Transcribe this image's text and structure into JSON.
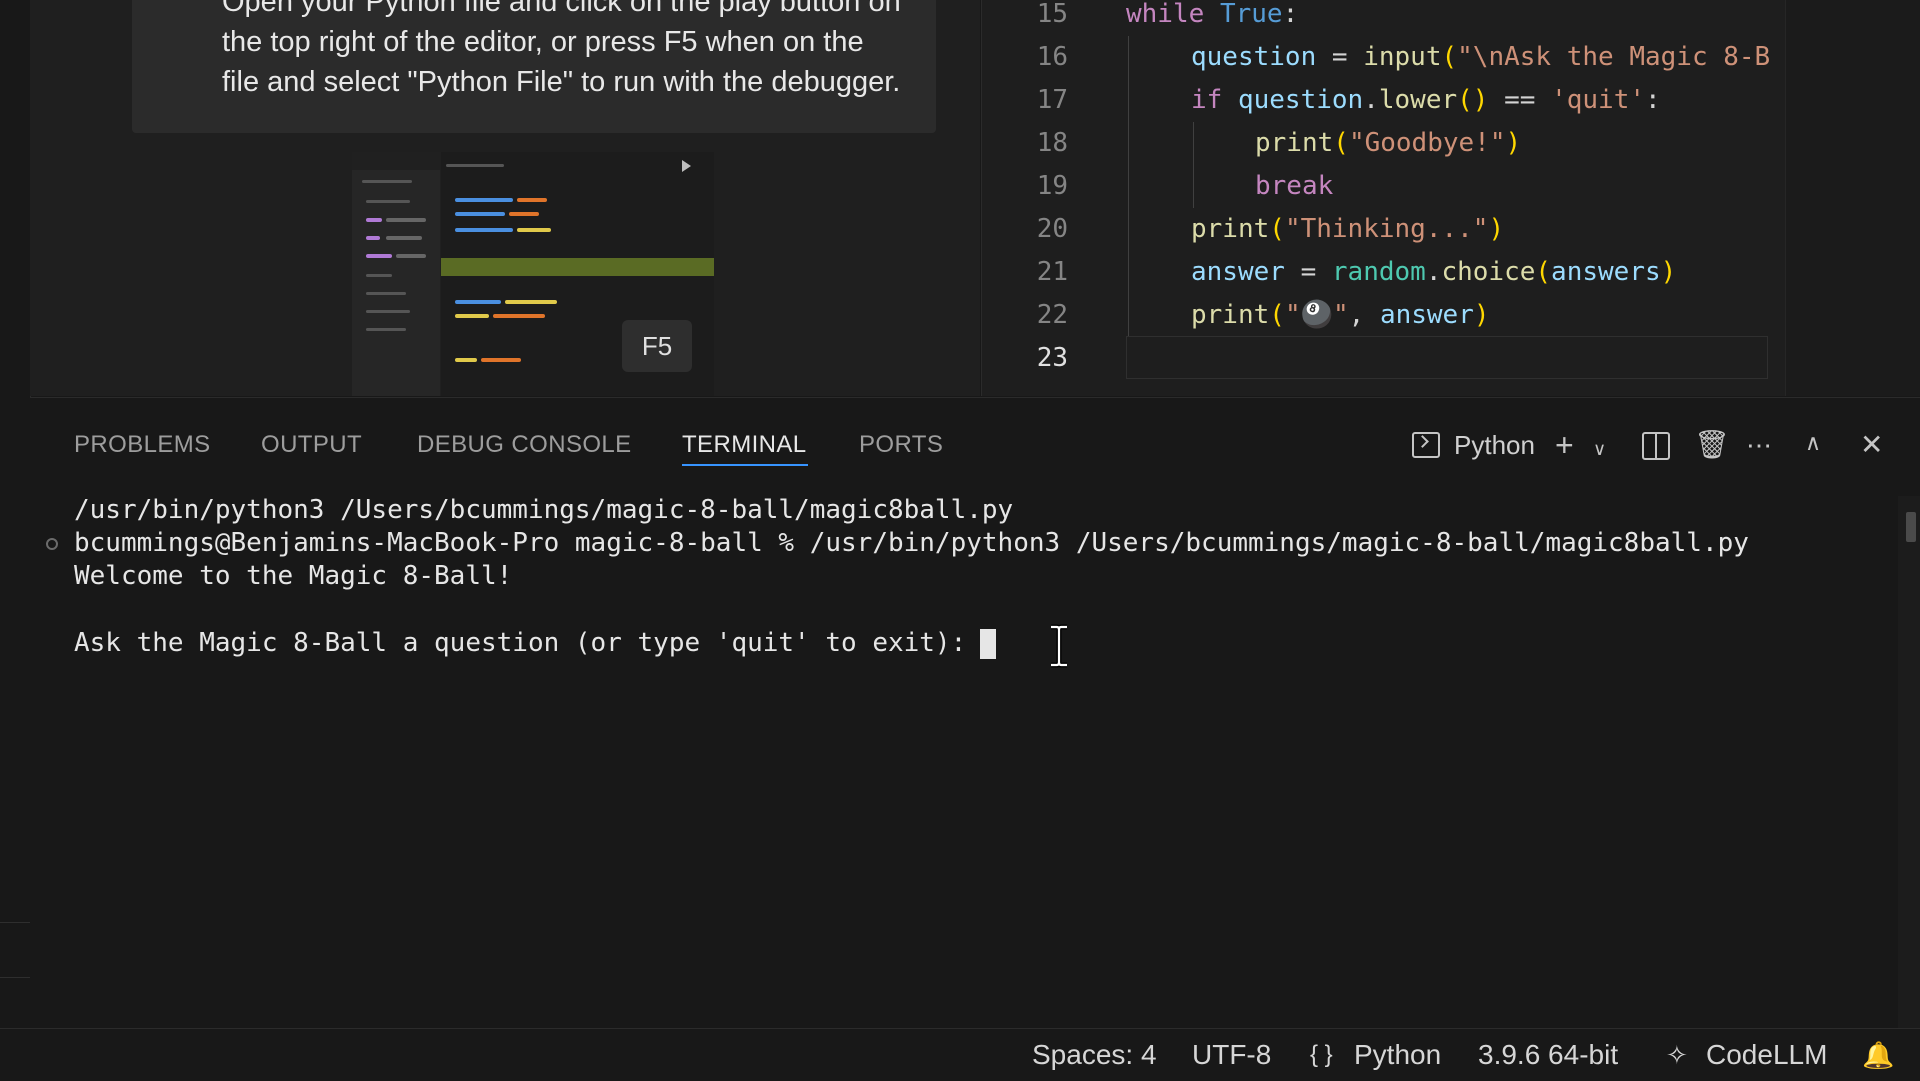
{
  "walkthrough": {
    "callout_text": "Open your Python file and click on the play button on the top right of the editor, or press F5 when on the file and select \"Python File\" to run with the debugger.",
    "key_hint": "F5"
  },
  "editor": {
    "lines": [
      {
        "n": "15"
      },
      {
        "n": "16"
      },
      {
        "n": "17"
      },
      {
        "n": "18"
      },
      {
        "n": "19"
      },
      {
        "n": "20"
      },
      {
        "n": "21"
      },
      {
        "n": "22"
      },
      {
        "n": "23"
      }
    ],
    "code": {
      "l15_kw": "while",
      "l15_true": "True",
      "l15_colon": ":",
      "l16_var": "question",
      "l16_eq": " = ",
      "l16_fn": "input",
      "l16_open": "(",
      "l16_str": "\"\\nAsk the Magic 8-B",
      "l17_kw": "if",
      "l17_var": "question",
      "l17_dot": ".",
      "l17_fn": "lower",
      "l17_paren": "()",
      "l17_eq": " == ",
      "l17_str": "'quit'",
      "l17_colon": ":",
      "l18_fn": "print",
      "l18_open": "(",
      "l18_str": "\"Goodbye!\"",
      "l18_close": ")",
      "l19_kw": "break",
      "l20_fn": "print",
      "l20_open": "(",
      "l20_str": "\"Thinking...\"",
      "l20_close": ")",
      "l21_var": "answer",
      "l21_eq": " = ",
      "l21_mod": "random",
      "l21_dot": ".",
      "l21_fn": "choice",
      "l21_open": "(",
      "l21_arg": "answers",
      "l21_close": ")",
      "l22_fn": "print",
      "l22_open": "(",
      "l22_str": "\"🎱\"",
      "l22_comma": ", ",
      "l22_arg": "answer",
      "l22_close": ")"
    }
  },
  "panel": {
    "tabs": [
      {
        "label": "PROBLEMS"
      },
      {
        "label": "OUTPUT"
      },
      {
        "label": "DEBUG CONSOLE"
      },
      {
        "label": "TERMINAL",
        "active": true
      },
      {
        "label": "PORTS"
      }
    ],
    "terminal_profile": "Python",
    "icons": {
      "new": "plus-icon",
      "dropdown": "chevron-down-icon",
      "split": "split-icon",
      "kill": "trash-icon",
      "more": "ellipsis-icon",
      "maximize": "chevron-up-icon",
      "close": "close-icon"
    },
    "terminal_lines": [
      "/usr/bin/python3 /Users/bcummings/magic-8-ball/magic8ball.py",
      "bcummings@Benjamins-MacBook-Pro magic-8-ball % /usr/bin/python3 /Users/bcummings/magic-8-ball/magic8ball.py",
      "Welcome to the Magic 8-Ball!",
      "",
      "Ask the Magic 8-Ball a question (or type 'quit' to exit): "
    ]
  },
  "statusbar": {
    "spaces": "Spaces: 4",
    "encoding": "UTF-8",
    "language_braces": "{ }",
    "language": "Python",
    "interpreter": "3.9.6 64-bit",
    "extension": "CodeLLM"
  },
  "colors": {
    "accent": "#3794ff",
    "background": "#181818",
    "editor_bg": "#1e1e1e"
  }
}
